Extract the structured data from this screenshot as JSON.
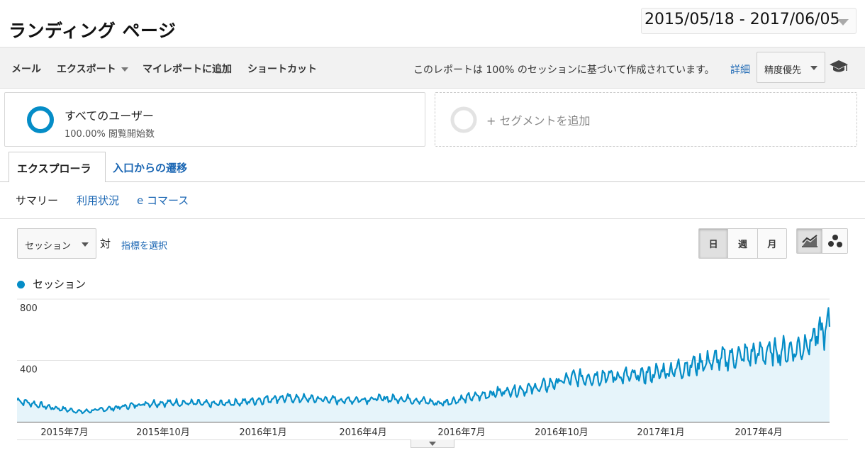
{
  "header": {
    "title": "ランディング ページ",
    "date_range": "2015/05/18 - 2017/06/05"
  },
  "toolbar": {
    "email": "メール",
    "export": "エクスポート",
    "add_to_dashboard": "マイレポートに追加",
    "shortcut": "ショートカット",
    "report_note": "このレポートは 100% のセッションに基づいて作成されています。",
    "detail_link": "詳細",
    "precision_label": "精度優先"
  },
  "segments": {
    "all_users": {
      "name": "すべてのユーザー",
      "stat": "100.00% 閲覧開始数"
    },
    "add_segment": "+ セグメントを追加"
  },
  "tabs": {
    "explorer": "エクスプローラ",
    "landing_flow": "入口からの遷移"
  },
  "subtabs": {
    "summary": "サマリー",
    "usage": "利用状況",
    "ecommerce": "e コマース"
  },
  "metric_row": {
    "metric": "セッション",
    "vs": "対",
    "choose_metric": "指標を選択",
    "periods": [
      "日",
      "週",
      "月"
    ],
    "active_period": "日"
  },
  "colors": {
    "series": "#058dc7",
    "area": "#e6f4fa",
    "link": "#1a66b3"
  },
  "chart_data": {
    "type": "area",
    "ylim": [
      0,
      800
    ],
    "yticks": [
      800,
      400
    ],
    "grid": true,
    "legend_position": "top-left",
    "x_start": "2015/05/18",
    "x_end": "2017/06/05",
    "xtick_labels": [
      "2015年7月",
      "2015年10月",
      "2016年1月",
      "2016年4月",
      "2016年7月",
      "2016年10月",
      "2017年1月",
      "2017年4月"
    ],
    "series": [
      {
        "name": "セッション",
        "x": [
          "2015-05",
          "2015-06",
          "2015-07",
          "2015-08",
          "2015-09",
          "2015-10",
          "2015-11",
          "2015-12",
          "2016-01",
          "2016-02",
          "2016-03",
          "2016-04",
          "2016-05",
          "2016-06",
          "2016-07",
          "2016-08",
          "2016-09",
          "2016-10",
          "2016-11",
          "2016-12",
          "2017-01",
          "2017-02",
          "2017-03",
          "2017-04",
          "2017-05",
          "2017-06"
        ],
        "values": [
          140,
          95,
          65,
          90,
          120,
          125,
          115,
          130,
          155,
          150,
          140,
          150,
          150,
          120,
          160,
          200,
          220,
          280,
          300,
          295,
          330,
          380,
          420,
          450,
          470,
          620
        ]
      }
    ]
  }
}
